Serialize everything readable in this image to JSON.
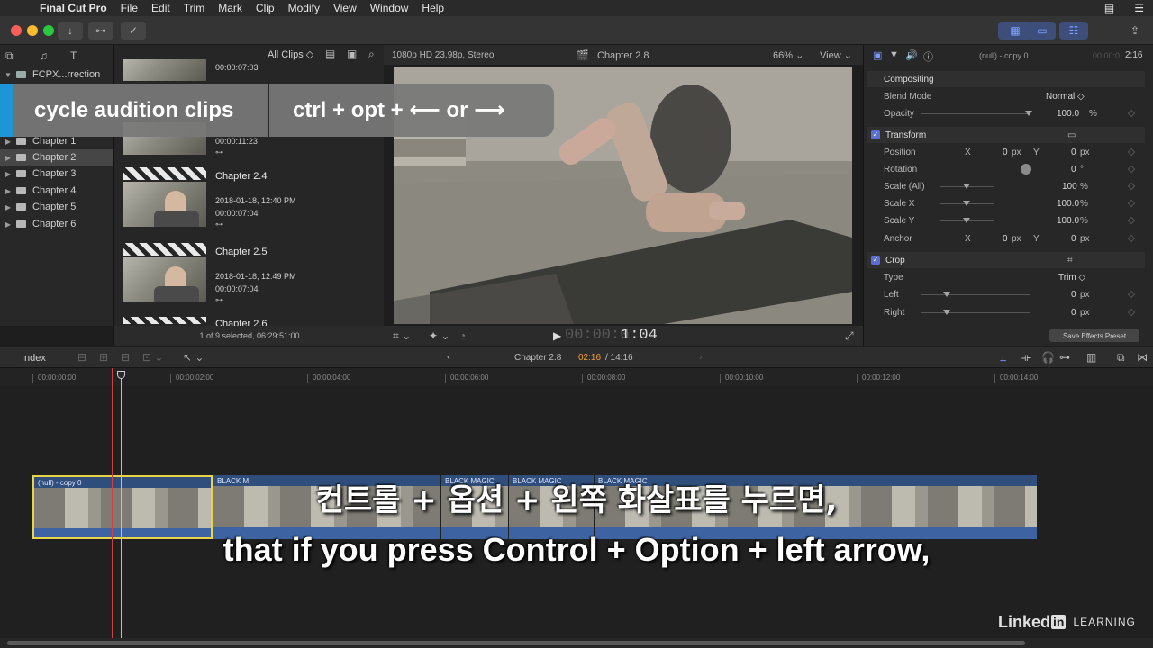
{
  "menubar": {
    "app": "Final Cut Pro",
    "items": [
      "File",
      "Edit",
      "Trim",
      "Mark",
      "Clip",
      "Modify",
      "View",
      "Window",
      "Help"
    ]
  },
  "browser": {
    "library_name": "FCPX...rrection",
    "filter": "All Clips",
    "events": [
      "Chapter 1",
      "Chapter 2",
      "Chapter 3",
      "Chapter 4",
      "Chapter 5",
      "Chapter 6"
    ],
    "clips": [
      {
        "title": "",
        "date": "",
        "duration": "00:00:07:03"
      },
      {
        "title": "",
        "date": "",
        "duration": "00:00:11:23"
      },
      {
        "title": "Chapter 2.4",
        "date": "2018-01-18, 12:40 PM",
        "duration": "00:00:07:04"
      },
      {
        "title": "Chapter 2.5",
        "date": "2018-01-18, 12:49 PM",
        "duration": "00:00:07:04"
      },
      {
        "title": "Chapter 2.6",
        "date": "",
        "duration": ""
      }
    ],
    "status": "1 of 9 selected, 06:29:51:00",
    "key_glyph": "⊶"
  },
  "banner": {
    "label": "cycle audition clips",
    "shortcut": "ctrl + opt + ⟵  or  ⟶"
  },
  "viewer": {
    "format": "1080p HD 23.98p, Stereo",
    "title": "Chapter 2.8",
    "zoom": "66%",
    "view": "View",
    "timecode_dim": "00:00:0",
    "timecode": "1:04"
  },
  "inspector": {
    "clip_name": "(null) - copy 0",
    "duration_dim": "00:00:0",
    "duration": "2:16",
    "sections": {
      "compositing": "Compositing",
      "transform": "Transform",
      "crop": "Crop"
    },
    "params": {
      "blend_mode": {
        "label": "Blend Mode",
        "value": "Normal ◇"
      },
      "opacity": {
        "label": "Opacity",
        "value": "100.0",
        "unit": "%"
      },
      "position": {
        "label": "Position",
        "x_label": "X",
        "x": "0",
        "x_unit": "px",
        "y_label": "Y",
        "y": "0",
        "y_unit": "px"
      },
      "rotation": {
        "label": "Rotation",
        "value": "0",
        "unit": "°"
      },
      "scale_all": {
        "label": "Scale (All)",
        "value": "100",
        "unit": "%"
      },
      "scale_x": {
        "label": "Scale X",
        "value": "100.0",
        "unit": "%"
      },
      "scale_y": {
        "label": "Scale Y",
        "value": "100.0",
        "unit": "%"
      },
      "anchor": {
        "label": "Anchor",
        "x_label": "X",
        "x": "0",
        "x_unit": "px",
        "y_label": "Y",
        "y": "0",
        "y_unit": "px"
      },
      "type": {
        "label": "Type",
        "value": "Trim ◇"
      },
      "left": {
        "label": "Left",
        "value": "0",
        "unit": "px"
      },
      "right": {
        "label": "Right",
        "value": "0",
        "unit": "px"
      }
    },
    "save_preset": "Save Effects Preset"
  },
  "timeline": {
    "index": "Index",
    "project": "Chapter 2.8",
    "position": "02:16",
    "total": "/ 14:16",
    "ruler": [
      "00:00:00:00",
      "00:00:02:00",
      "00:00:04:00",
      "00:00:06:00",
      "00:00:08:00",
      "00:00:10:00",
      "00:00:12:00",
      "00:00:14:00"
    ],
    "clip_labels": [
      "(null) - copy 0",
      "BLACK M",
      "BLACK MAGIC",
      "BLACK MAGIC",
      "BLACK MAGIC"
    ]
  },
  "subtitles": {
    "korean": "컨트롤 + 옵션 + 왼쪽 화살표를 누르면,",
    "english": "that if you press Control + Option + left arrow,"
  },
  "watermark": {
    "brand": "Linked",
    "in": "in",
    "learning": "LEARNING"
  },
  "colors": {
    "accent_blue": "#1d95d6",
    "selection_yellow": "#e8d34a",
    "playhead_red": "#d04040",
    "timecode_orange": "#f0a030"
  }
}
